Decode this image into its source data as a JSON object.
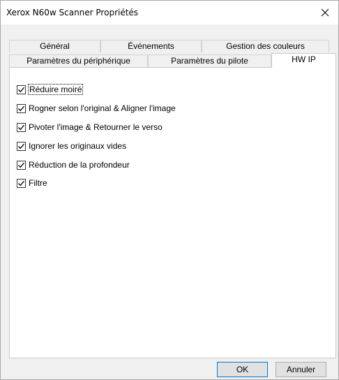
{
  "window": {
    "title": "Xerox N60w Scanner Propriétés"
  },
  "tabs": {
    "row1": [
      "Général",
      "Événements",
      "Gestion des couleurs"
    ],
    "row2": [
      "Paramètres du périphérique",
      "Paramètres du pilote",
      "HW IP"
    ]
  },
  "options": [
    {
      "label": "Réduire moiré",
      "checked": true
    },
    {
      "label": "Rogner selon l'original & Aligner l'image",
      "checked": true
    },
    {
      "label": "Pivoter l'image & Retourner le verso",
      "checked": true
    },
    {
      "label": "Ignorer les originaux vides",
      "checked": true
    },
    {
      "label": "Réduction de la profondeur",
      "checked": true
    },
    {
      "label": "Filtre",
      "checked": true
    }
  ],
  "buttons": {
    "ok": "OK",
    "cancel": "Annuler"
  }
}
